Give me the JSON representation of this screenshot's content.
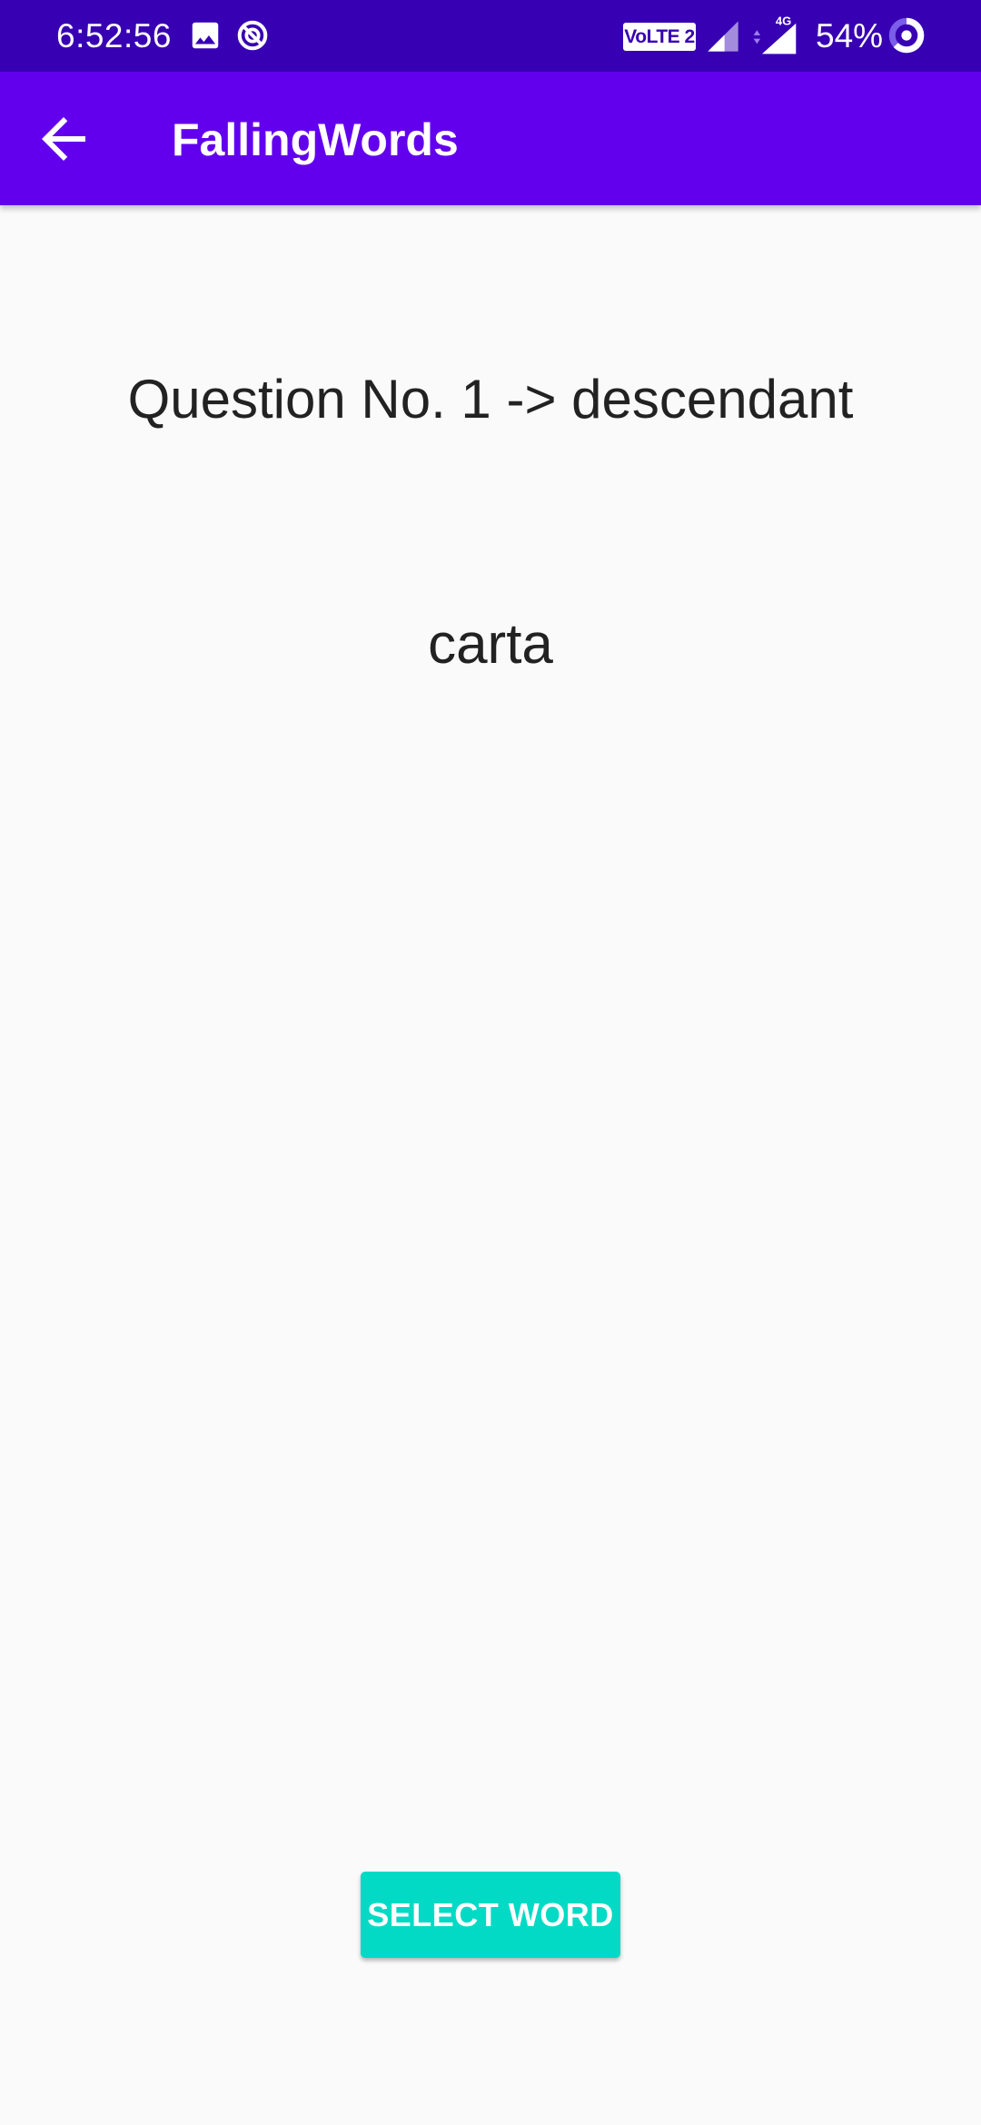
{
  "status_bar": {
    "time": "6:52:56",
    "network_badge": "VoLTE 2",
    "network_type": "4G",
    "battery_percent": "54%",
    "icons": [
      "gallery-icon",
      "data-saver-icon",
      "signal-icon",
      "signal-4g-icon",
      "battery-icon"
    ],
    "background_color": "#3700b3"
  },
  "app_bar": {
    "title": "FallingWords",
    "back_icon": "arrow-back-icon",
    "background_color": "#6200ee"
  },
  "main": {
    "question": "Question No. 1 -> descendant",
    "falling_word": "carta",
    "select_button_label": "SELECT WORD",
    "button_color": "#03dac5"
  }
}
